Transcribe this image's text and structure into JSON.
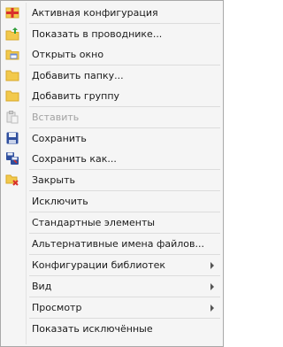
{
  "menu": {
    "items": [
      {
        "label": "Активная конфигурация",
        "icon": "active-config-icon"
      },
      {
        "sep": true
      },
      {
        "label": "Показать в проводнике...",
        "icon": "folder-up-arrow-icon"
      },
      {
        "label": "Открыть окно",
        "icon": "open-window-icon"
      },
      {
        "sep": true
      },
      {
        "label": "Добавить папку...",
        "icon": "folder-icon"
      },
      {
        "label": "Добавить группу",
        "icon": "folder-icon"
      },
      {
        "sep": true
      },
      {
        "label": "Вставить",
        "icon": "paste-icon",
        "disabled": true
      },
      {
        "sep": true
      },
      {
        "label": "Сохранить",
        "icon": "save-icon"
      },
      {
        "label": "Сохранить как...",
        "icon": "save-as-icon"
      },
      {
        "sep": true
      },
      {
        "label": "Закрыть",
        "icon": "close-folder-icon"
      },
      {
        "sep": true
      },
      {
        "label": "Исключить",
        "icon": ""
      },
      {
        "sep": true
      },
      {
        "label": "Стандартные элементы",
        "icon": ""
      },
      {
        "sep": true
      },
      {
        "label": "Альтернативные имена файлов...",
        "icon": ""
      },
      {
        "sep": true
      },
      {
        "label": "Конфигурации библиотек",
        "icon": "",
        "submenu": true
      },
      {
        "sep": true
      },
      {
        "label": "Вид",
        "icon": "",
        "submenu": true
      },
      {
        "sep": true
      },
      {
        "label": "Просмотр",
        "icon": "",
        "submenu": true
      },
      {
        "sep": true
      },
      {
        "label": "Показать исключённые",
        "icon": ""
      }
    ]
  },
  "colors": {
    "folder": "#f2c94c",
    "folder_dark": "#d8a92a",
    "save": "#2f4f9e",
    "green": "#2e9e3a",
    "red": "#d9302c"
  }
}
